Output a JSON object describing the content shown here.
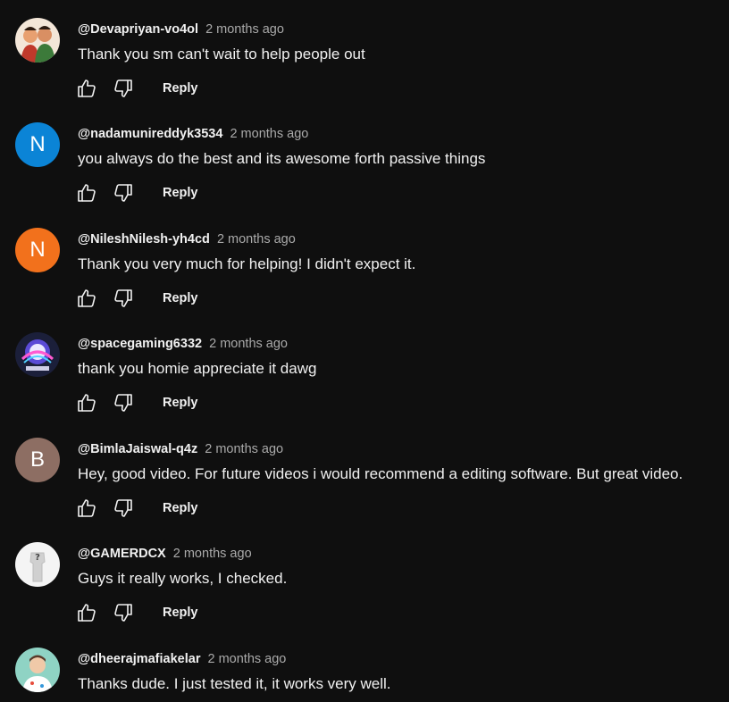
{
  "comments": [
    {
      "author": "@Devapriyan-vo4ol",
      "time": "2 months ago",
      "text": "Thank you sm can't wait to help people out",
      "avatar": {
        "type": "image",
        "colors": [
          "#e8a070",
          "#c0392b",
          "#3c7a3a"
        ]
      },
      "reply_label": "Reply"
    },
    {
      "author": "@nadamunireddyk3534",
      "time": "2 months ago",
      "text": "you always do the best and its awesome forth passive things",
      "avatar": {
        "type": "letter",
        "letter": "N",
        "color": "#0b84d6"
      },
      "reply_label": "Reply"
    },
    {
      "author": "@NileshNilesh-yh4cd",
      "time": "2 months ago",
      "text": "Thank you very much for helping! I didn't expect it.",
      "avatar": {
        "type": "letter",
        "letter": "N",
        "color": "#f2711c"
      },
      "reply_label": "Reply"
    },
    {
      "author": "@spacegaming6332",
      "time": "2 months ago",
      "text": "thank you homie appreciate it dawg",
      "avatar": {
        "type": "image",
        "colors": [
          "#1b1f3a",
          "#5a4bd6",
          "#e9e9ff"
        ]
      },
      "reply_label": "Reply"
    },
    {
      "author": "@BimlaJaiswal-q4z",
      "time": "2 months ago",
      "text": "Hey, good video. For future videos i would recommend a editing software. But great video.",
      "avatar": {
        "type": "letter",
        "letter": "B",
        "color": "#8d6e63"
      },
      "reply_label": "Reply"
    },
    {
      "author": "@GAMERDCX",
      "time": "2 months ago",
      "text": "Guys it really works, I checked.",
      "avatar": {
        "type": "image",
        "colors": [
          "#f4f4f4",
          "#d0d0d0",
          "#444444"
        ]
      },
      "reply_label": "Reply"
    },
    {
      "author": "@dheerajmafiakelar",
      "time": "2 months ago",
      "text": "Thanks dude. I just tested it, it works very well.",
      "avatar": {
        "type": "image",
        "colors": [
          "#8fd3c4",
          "#f0c9a8",
          "#5a3a2a"
        ]
      },
      "reply_label": "Reply"
    }
  ],
  "icons": {
    "like": "thumbs-up-icon",
    "dislike": "thumbs-down-icon"
  },
  "colors": {
    "background": "#0f0f0f",
    "text": "#f1f1f1",
    "secondary_text": "#aaaaaa"
  }
}
